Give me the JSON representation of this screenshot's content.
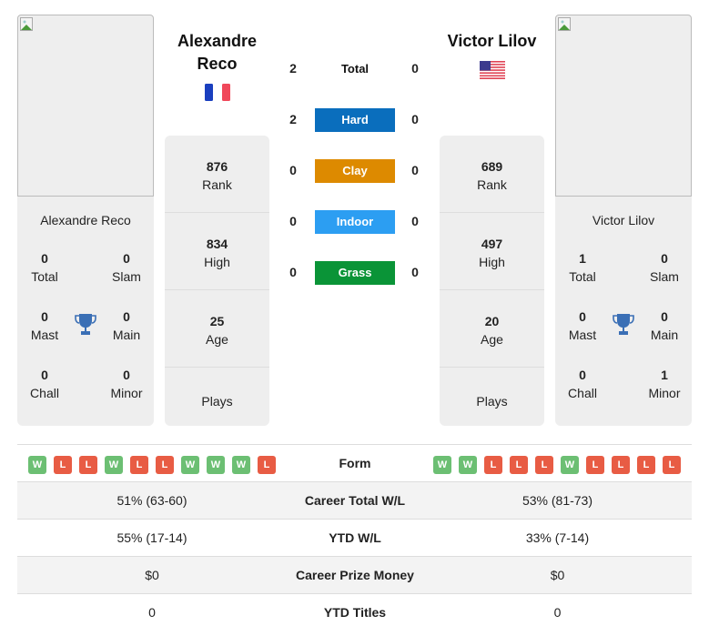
{
  "players": {
    "left": {
      "name": "Alexandre Reco",
      "name_line1": "Alexandre",
      "name_line2": "Reco",
      "country": "France",
      "flag_icon": "flag-fr",
      "rank": "876",
      "rank_label": "Rank",
      "high": "834",
      "high_label": "High",
      "age": "25",
      "age_label": "Age",
      "plays_label": "Plays",
      "titles": {
        "total": "0",
        "total_label": "Total",
        "slam": "0",
        "slam_label": "Slam",
        "mast": "0",
        "mast_label": "Mast",
        "main": "0",
        "main_label": "Main",
        "chall": "0",
        "chall_label": "Chall",
        "minor": "0",
        "minor_label": "Minor"
      },
      "form": [
        "W",
        "L",
        "L",
        "W",
        "L",
        "L",
        "W",
        "W",
        "W",
        "L"
      ]
    },
    "right": {
      "name": "Victor Lilov",
      "name_line1": "Victor Lilov",
      "country": "USA",
      "flag_icon": "flag-us",
      "rank": "689",
      "rank_label": "Rank",
      "high": "497",
      "high_label": "High",
      "age": "20",
      "age_label": "Age",
      "plays_label": "Plays",
      "titles": {
        "total": "1",
        "total_label": "Total",
        "slam": "0",
        "slam_label": "Slam",
        "mast": "0",
        "mast_label": "Mast",
        "main": "0",
        "main_label": "Main",
        "chall": "0",
        "chall_label": "Chall",
        "minor": "1",
        "minor_label": "Minor"
      },
      "form": [
        "W",
        "W",
        "L",
        "L",
        "L",
        "W",
        "L",
        "L",
        "L",
        "L"
      ]
    }
  },
  "h2h": [
    {
      "label": "Total",
      "left": "2",
      "right": "0",
      "color": ""
    },
    {
      "label": "Hard",
      "left": "2",
      "right": "0",
      "color": "#0a6ebd"
    },
    {
      "label": "Clay",
      "left": "0",
      "right": "0",
      "color": "#dd8a00"
    },
    {
      "label": "Indoor",
      "left": "0",
      "right": "0",
      "color": "#2c9ef2"
    },
    {
      "label": "Grass",
      "left": "0",
      "right": "0",
      "color": "#0a9437"
    }
  ],
  "table": {
    "form_label": "Form",
    "rows": [
      {
        "label": "Career Total W/L",
        "left": "51% (63-60)",
        "right": "53% (81-73)"
      },
      {
        "label": "YTD W/L",
        "left": "55% (17-14)",
        "right": "33% (7-14)"
      },
      {
        "label": "Career Prize Money",
        "left": "$0",
        "right": "$0"
      },
      {
        "label": "YTD Titles",
        "left": "0",
        "right": "0"
      }
    ]
  },
  "colors": {
    "win": "#6cbf73",
    "loss": "#e85c44",
    "trophy": "#3a6fb5"
  }
}
